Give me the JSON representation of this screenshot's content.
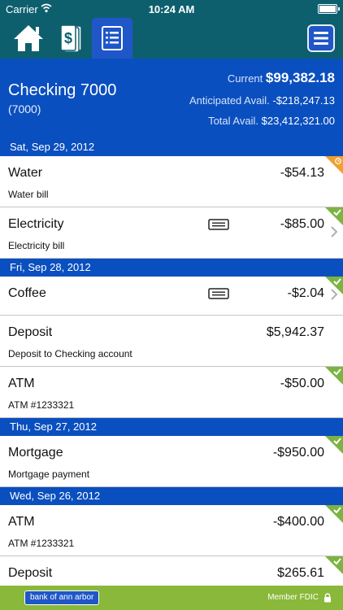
{
  "status_bar": {
    "carrier": "Carrier",
    "time": "10:24 AM"
  },
  "toolbar": {
    "tabs": [
      {
        "icon": "home-icon"
      },
      {
        "icon": "money-icon"
      },
      {
        "icon": "register-icon",
        "active": true
      }
    ],
    "menu_icon": "menu-icon"
  },
  "account": {
    "name": "Checking 7000",
    "number": "(7000)",
    "current_label": "Current",
    "current_value": "$99,382.18",
    "anticipated_label": "Anticipated Avail.",
    "anticipated_value": "-$218,247.13",
    "total_label": "Total Avail.",
    "total_value": "$23,412,321.00"
  },
  "groups": [
    {
      "date": "Sat, Sep 29, 2012",
      "transactions": [
        {
          "payee": "Water",
          "amount": "-$54.13",
          "memo": "Water bill",
          "status": "pending"
        },
        {
          "payee": "Electricity",
          "amount": "-$85.00",
          "memo": "Electricity bill",
          "status": "cleared",
          "receipt": true,
          "chevron": true
        }
      ]
    },
    {
      "date": "Fri, Sep 28, 2012",
      "transactions": [
        {
          "payee": "Coffee",
          "amount": "-$2.04",
          "memo": "",
          "status": "cleared",
          "receipt": true,
          "chevron": true
        },
        {
          "payee": "Deposit",
          "amount": "$5,942.37",
          "memo": "Deposit to Checking account",
          "status": "none"
        },
        {
          "payee": "ATM",
          "amount": "-$50.00",
          "memo": "ATM #1233321",
          "status": "cleared"
        }
      ]
    },
    {
      "date": "Thu, Sep 27, 2012",
      "transactions": [
        {
          "payee": "Mortgage",
          "amount": "-$950.00",
          "memo": "Mortgage payment",
          "status": "cleared"
        }
      ]
    },
    {
      "date": "Wed, Sep 26, 2012",
      "transactions": [
        {
          "payee": "ATM",
          "amount": "-$400.00",
          "memo": "ATM #1233321",
          "status": "cleared"
        },
        {
          "payee": "Deposit",
          "amount": "$265.61",
          "memo": "",
          "status": "cleared"
        }
      ]
    }
  ],
  "footer": {
    "logo_text": "bank of ann arbor",
    "member_text": "Member FDIC"
  },
  "colors": {
    "toolbar_bg": "#0d5f6e",
    "brand_blue": "#0a4fbf",
    "tab_active": "#1f56c8",
    "cleared_green": "#7cb342",
    "pending_orange": "#f0a030",
    "footer_green": "#8ab83a"
  }
}
